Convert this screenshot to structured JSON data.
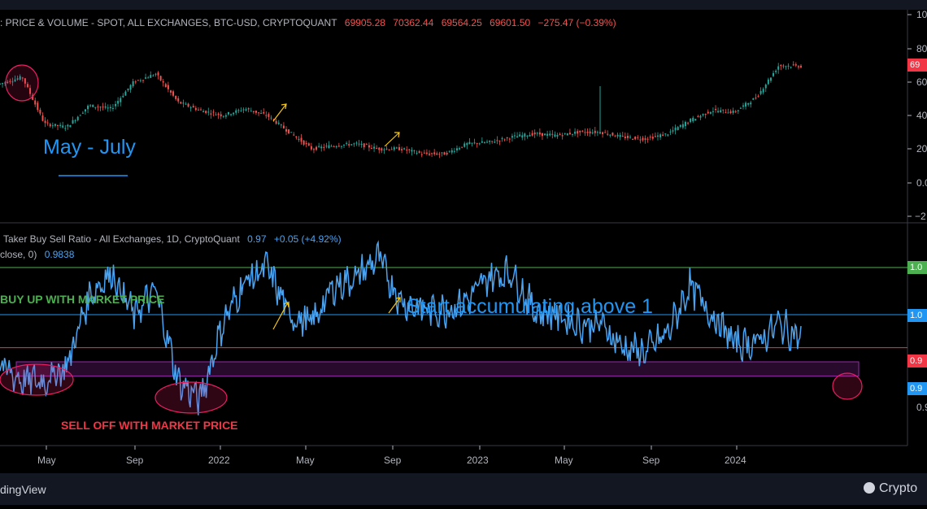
{
  "colors": {
    "background": "#000000",
    "up_candle": "#26a69a",
    "down_candle": "#ef5350",
    "ratio_line": "#4aa3f0",
    "level_green": "#4caf50",
    "level_blue": "#2196f3",
    "level_red": "#f23645",
    "zone_purple": "#9c27b0",
    "circle_pink": "#e91e63",
    "arrow_yellow": "#f5c518",
    "annotation_blue": "#2196f3"
  },
  "top_legend": {
    "title": ": PRICE & VOLUME - SPOT, ALL EXCHANGES, BTC-USD, CRYPTOQUANT",
    "open": "69905.28",
    "high": "70362.44",
    "low": "69564.25",
    "close": "69601.50",
    "change": "−275.47 (−0.39%)"
  },
  "bottom_legend": {
    "title": "Taker Buy Sell Ratio - All Exchanges, 1D, CryptoQuant",
    "value": "0.97",
    "change": "+0.05 (+4.92%)",
    "line2_label": "close, 0)",
    "line2_value": "0.9838"
  },
  "annotations": {
    "may_july": "May - July",
    "buy_up": "BUY UP WITH MARKET PRICE",
    "sell_off": "SELL OFF WITH MARKET PRICE",
    "start_accumulating": "Start accumulating above 1"
  },
  "right_axis_top": [
    "10",
    "80",
    "60",
    "40",
    "20",
    "0.0",
    "−2"
  ],
  "right_axis_top_tag": "69",
  "right_axis_bottom_tags": [
    "1.0",
    "1.0",
    "0.9",
    "0.9"
  ],
  "right_axis_bottom_plain": "0.9",
  "x_axis_labels": [
    "May",
    "Sep",
    "2022",
    "May",
    "Sep",
    "2023",
    "May",
    "Sep",
    "2024"
  ],
  "footer": {
    "left_brand": "dingView",
    "right_brand": "Crypto"
  },
  "chart_data": [
    {
      "type": "line",
      "name": "BTC-USD price (candlesticks)",
      "x_range": [
        "2021-04",
        "2024-04"
      ],
      "y_unit": "thousand USD",
      "ylim": [
        -2,
        100
      ],
      "x": [
        "2021-04",
        "2021-05",
        "2021-06",
        "2021-07",
        "2021-08",
        "2021-09",
        "2021-10",
        "2021-11",
        "2021-12",
        "2022-01",
        "2022-02",
        "2022-03",
        "2022-04",
        "2022-05",
        "2022-06",
        "2022-07",
        "2022-08",
        "2022-09",
        "2022-10",
        "2022-11",
        "2022-12",
        "2023-01",
        "2023-02",
        "2023-03",
        "2023-04",
        "2023-05",
        "2023-06",
        "2023-07",
        "2023-08",
        "2023-09",
        "2023-10",
        "2023-11",
        "2023-12",
        "2024-01",
        "2024-02",
        "2024-03",
        "2024-04"
      ],
      "values": [
        59,
        63,
        35,
        33,
        46,
        44,
        60,
        65,
        48,
        43,
        40,
        44,
        40,
        30,
        20,
        22,
        23,
        20,
        20,
        17,
        17,
        23,
        24,
        27,
        29,
        28,
        30,
        30,
        27,
        26,
        29,
        37,
        43,
        42,
        51,
        70,
        69.6
      ]
    },
    {
      "type": "line",
      "name": "Taker Buy Sell Ratio",
      "ylim": [
        0.88,
        1.1
      ],
      "x": [
        "2021-04",
        "2021-05",
        "2021-06",
        "2021-07",
        "2021-08",
        "2021-09",
        "2021-10",
        "2021-11",
        "2021-12",
        "2022-01",
        "2022-02",
        "2022-03",
        "2022-04",
        "2022-05",
        "2022-06",
        "2022-07",
        "2022-08",
        "2022-09",
        "2022-10",
        "2022-11",
        "2022-12",
        "2023-01",
        "2023-02",
        "2023-03",
        "2023-04",
        "2023-05",
        "2023-06",
        "2023-07",
        "2023-08",
        "2023-09",
        "2023-10",
        "2023-11",
        "2023-12",
        "2024-01",
        "2024-02",
        "2024-03",
        "2024-04"
      ],
      "values": [
        0.945,
        0.93,
        0.93,
        0.945,
        1.02,
        1.045,
        1.0,
        1.025,
        0.93,
        0.91,
        0.99,
        1.035,
        1.05,
        1.0,
        0.99,
        1.03,
        1.04,
        1.06,
        1.015,
        1.005,
        1.005,
        1.015,
        1.04,
        1.045,
        1.005,
        1.0,
        0.99,
        0.99,
        0.965,
        0.96,
        0.98,
        1.03,
        1.0,
        0.97,
        0.97,
        0.99,
        0.975
      ],
      "reference_levels": [
        1.05,
        1.0,
        0.965,
        0.945
      ],
      "zone": [
        0.935,
        0.95
      ]
    }
  ]
}
